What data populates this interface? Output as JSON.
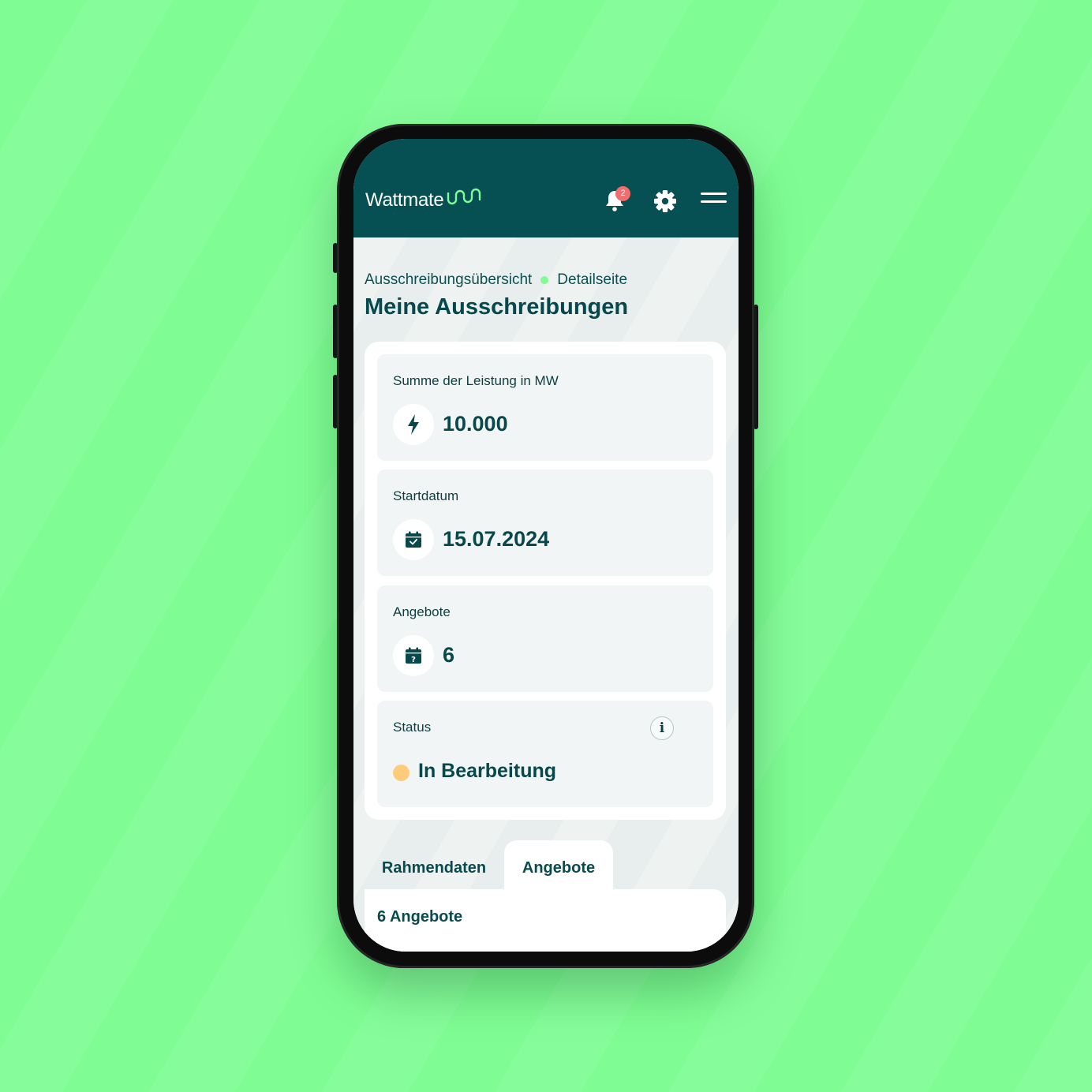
{
  "header": {
    "logo_text": "Wattmate",
    "notification_count": "2"
  },
  "breadcrumb": {
    "items": [
      "Ausschreibungsübersicht",
      "Detailseite"
    ]
  },
  "page_title": "Meine Ausschreibungen",
  "summary": {
    "tiles": [
      {
        "label": "Summe der Leistung in MW",
        "value": "10.000",
        "icon": "lightning-icon"
      },
      {
        "label": "Startdatum",
        "value": "15.07.2024",
        "icon": "calendar-check-icon"
      },
      {
        "label": "Angebote",
        "value": "6",
        "icon": "calendar-question-icon"
      }
    ],
    "status": {
      "label": "Status",
      "value": "In Bearbeitung",
      "color": "#fdcc7a"
    }
  },
  "tabs": [
    {
      "label": "Rahmendaten",
      "active": false
    },
    {
      "label": "Angebote",
      "active": true
    }
  ],
  "panel": {
    "title": "6 Angebote"
  },
  "colors": {
    "header_bg": "#064f53",
    "accent_green": "#7ffd94",
    "text_dark": "#07484c",
    "badge_red": "#f26d6d"
  }
}
